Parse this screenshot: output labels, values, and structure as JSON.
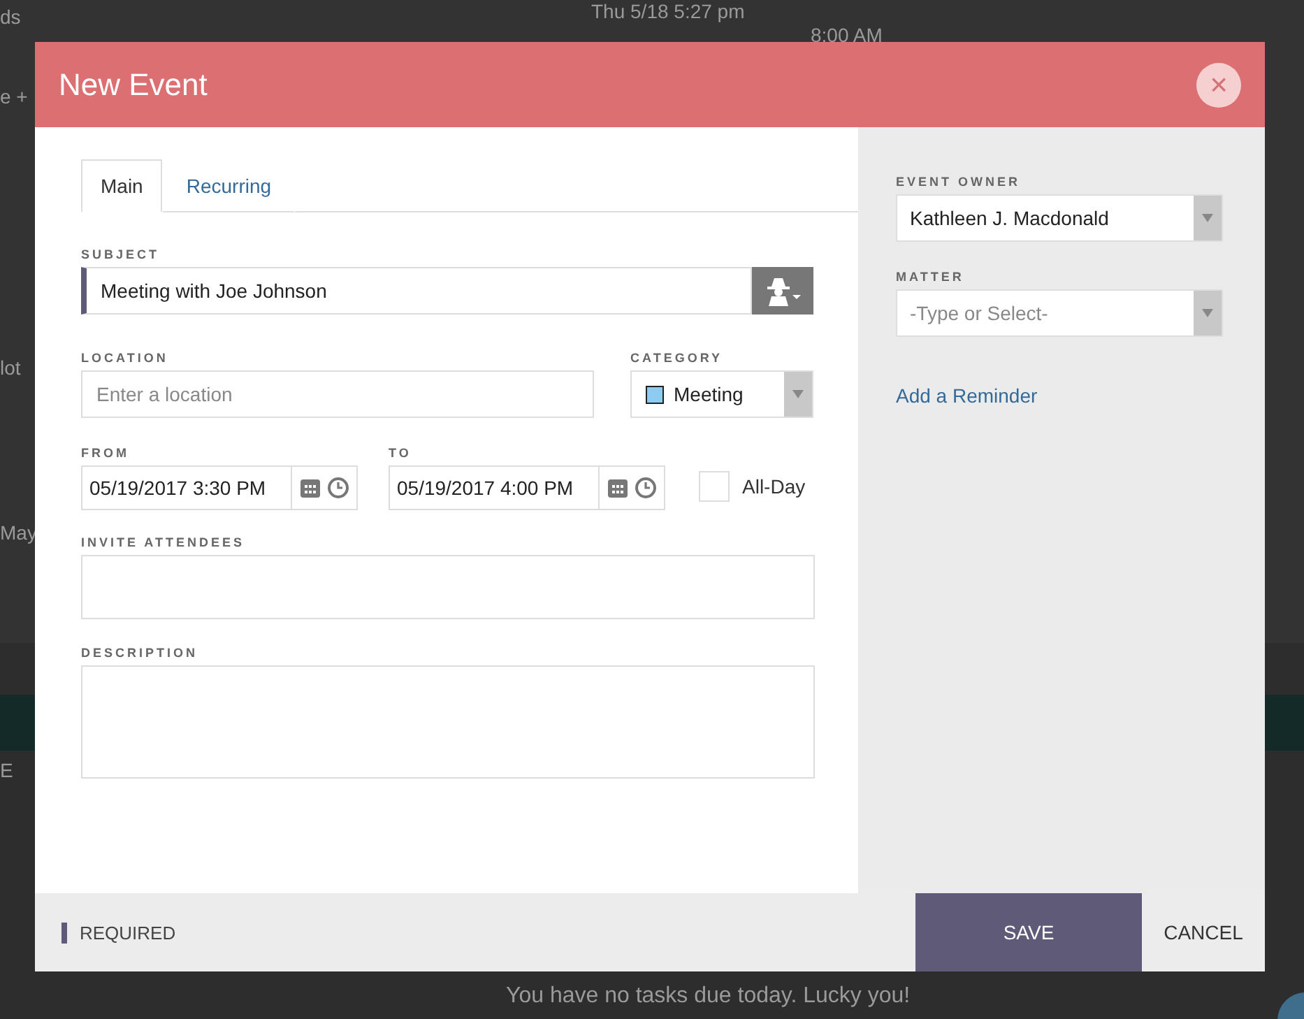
{
  "background": {
    "texts": [
      {
        "kind": "top-left",
        "text": "ds"
      },
      {
        "kind": "top-date",
        "text": "Thu 5/18 5:27 pm"
      },
      {
        "kind": "time",
        "text": "8:00 AM"
      },
      {
        "kind": "left",
        "text": "e +"
      },
      {
        "kind": "left2",
        "text": "lot"
      },
      {
        "kind": "left3",
        "text": "May"
      },
      {
        "kind": "teal",
        "text": "E"
      },
      {
        "kind": "bottom",
        "text": "You have no tasks due today. Lucky you!"
      }
    ]
  },
  "dialog": {
    "title": "New Event",
    "close_icon": "×",
    "tabs": [
      {
        "label": "Main",
        "selected": true
      },
      {
        "label": "Recurring",
        "selected": false
      }
    ],
    "subject": {
      "label": "SUBJECT",
      "value": "Meeting with Joe Johnson",
      "required": true
    },
    "location": {
      "label": "LOCATION",
      "placeholder": "Enter a location"
    },
    "category": {
      "label": "CATEGORY",
      "value": "Meeting",
      "color": "#8ccbf2"
    },
    "from": {
      "label": "FROM",
      "value": "05/19/2017 3:30 PM"
    },
    "to": {
      "label": "TO",
      "value": "05/19/2017 4:00 PM"
    },
    "all_day": {
      "label": "All-Day",
      "checked": false
    },
    "invite": {
      "label": "INVITE ATTENDEES"
    },
    "description": {
      "label": "DESCRIPTION"
    },
    "event_owner": {
      "label": "EVENT OWNER",
      "value": "Kathleen J. Macdonald"
    },
    "matter": {
      "label": "MATTER",
      "placeholder": "-Type or Select-"
    },
    "reminder_link": "Add a Reminder",
    "footer": {
      "required_label": "REQUIRED",
      "save": "SAVE",
      "cancel": "CANCEL"
    }
  }
}
